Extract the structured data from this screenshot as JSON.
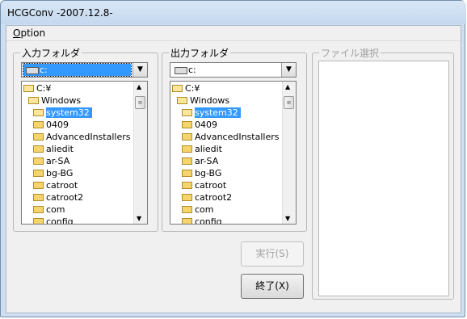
{
  "window": {
    "title": "HCGConv  -2007.12.8-"
  },
  "menu": {
    "option_label": "Option",
    "option_mnemonic": "O"
  },
  "input_panel": {
    "label": "入力フォルダ",
    "drive": "c:",
    "tree": [
      "C:¥",
      "Windows",
      "system32",
      "0409",
      "AdvancedInstallers",
      "aliedit",
      "ar-SA",
      "bg-BG",
      "catroot",
      "catroot2",
      "com",
      "config"
    ],
    "selected_index": 2
  },
  "output_panel": {
    "label": "出力フォルダ",
    "drive": "c:",
    "tree": [
      "C:¥",
      "Windows",
      "system32",
      "0409",
      "AdvancedInstallers",
      "aliedit",
      "ar-SA",
      "bg-BG",
      "catroot",
      "catroot2",
      "com",
      "config"
    ],
    "selected_index": 2
  },
  "file_panel": {
    "label": "ファイル選択"
  },
  "buttons": {
    "execute_label": "実行(S)",
    "exit_label": "終了(X)"
  },
  "icons": {
    "dropdown": "chevron-down-icon",
    "folder": "folder-icon",
    "drive": "drive-icon"
  }
}
